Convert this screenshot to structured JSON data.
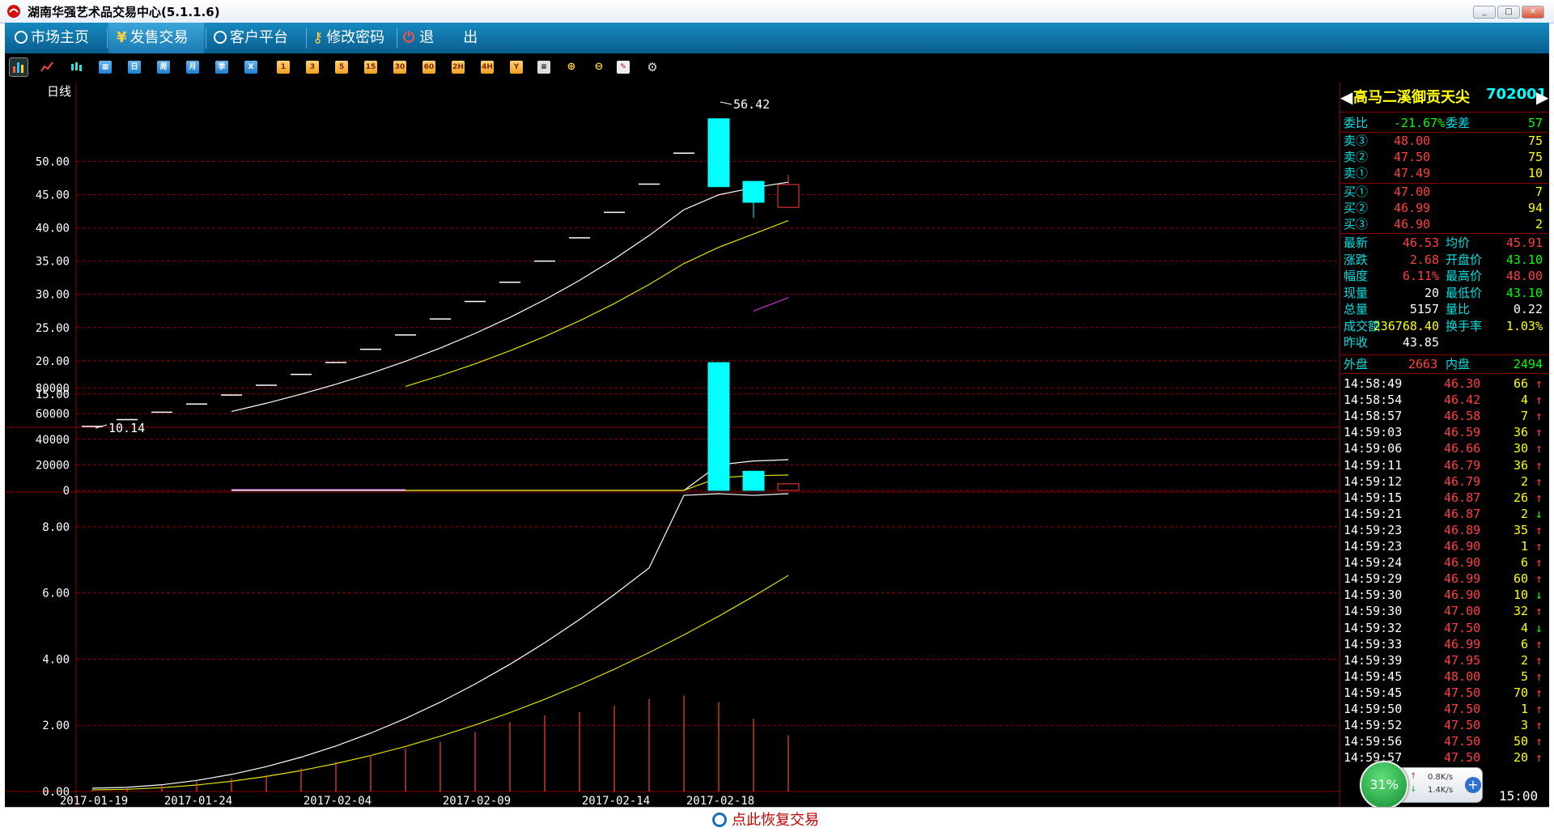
{
  "window": {
    "title": "湖南华强艺术品交易中心(5.1.1.6)",
    "controls": [
      "_",
      "□",
      "✕"
    ]
  },
  "menu": [
    {
      "label": "市场主页",
      "icon": "globe-icon"
    },
    {
      "label": "发售交易",
      "icon": "yen-icon"
    },
    {
      "label": "客户平台",
      "icon": "globe-icon"
    },
    {
      "label": "修改密码",
      "icon": "key-icon"
    },
    {
      "label": "退　　出",
      "icon": "power-icon"
    }
  ],
  "toolbar": {
    "period_buttons": [
      "日",
      "周",
      "月",
      "季",
      "X"
    ],
    "minute_buttons": [
      "1",
      "3",
      "5",
      "15",
      "30",
      "60",
      "2H",
      "4H",
      "Y"
    ]
  },
  "chart": {
    "period_label": "日线",
    "price_labels": [
      "50.00",
      "45.00",
      "40.00",
      "35.00",
      "30.00",
      "25.00",
      "20.00",
      "15.00"
    ],
    "volume_labels": [
      "80000",
      "60000",
      "40000",
      "20000",
      "0"
    ],
    "indicator_labels": [
      "8.00",
      "6.00",
      "4.00",
      "2.00",
      "0.00"
    ],
    "x_labels": [
      "2017-01-19",
      "2017-01-24",
      "2017-02-04",
      "2017-02-09",
      "2017-02-14",
      "2017-02-18"
    ],
    "max_label": "56.42",
    "min_label": "10.14"
  },
  "chart_data": {
    "type": "candlestick",
    "price_axis": {
      "ylim": [
        10,
        57
      ],
      "ticks": [
        15,
        20,
        25,
        30,
        35,
        40,
        45,
        50
      ]
    },
    "volume_axis": {
      "ylim": [
        0,
        100000
      ],
      "ticks": [
        0,
        20000,
        40000,
        60000,
        80000
      ]
    },
    "indicator_axis": {
      "ylim": [
        0,
        9
      ],
      "ticks": [
        0,
        2,
        4,
        6,
        8
      ]
    },
    "dates": [
      "2017-01-19",
      "2017-01-24",
      "2017-02-04",
      "2017-02-09",
      "2017-02-14",
      "2017-02-18"
    ],
    "candles": [
      {
        "open": 10.14,
        "close": 10.14,
        "high": 10.14,
        "low": 10.14
      },
      {
        "open": 11.15,
        "close": 11.15,
        "high": 11.15,
        "low": 11.15
      },
      {
        "open": 12.27,
        "close": 12.27,
        "high": 12.27,
        "low": 12.27
      },
      {
        "open": 13.5,
        "close": 13.5,
        "high": 13.5,
        "low": 13.5
      },
      {
        "open": 14.85,
        "close": 14.85,
        "high": 14.85,
        "low": 14.85
      },
      {
        "open": 16.33,
        "close": 16.33,
        "high": 16.33,
        "low": 16.33
      },
      {
        "open": 17.96,
        "close": 17.96,
        "high": 17.96,
        "low": 17.96
      },
      {
        "open": 19.76,
        "close": 19.76,
        "high": 19.76,
        "low": 19.76
      },
      {
        "open": 21.73,
        "close": 21.73,
        "high": 21.73,
        "low": 21.73
      },
      {
        "open": 23.9,
        "close": 23.9,
        "high": 23.9,
        "low": 23.9
      },
      {
        "open": 26.3,
        "close": 26.3,
        "high": 26.3,
        "low": 26.3
      },
      {
        "open": 28.93,
        "close": 28.93,
        "high": 28.93,
        "low": 28.93
      },
      {
        "open": 31.82,
        "close": 31.82,
        "high": 31.82,
        "low": 31.82
      },
      {
        "open": 35.0,
        "close": 35.0,
        "high": 35.0,
        "low": 35.0
      },
      {
        "open": 38.5,
        "close": 38.5,
        "high": 38.5,
        "low": 38.5
      },
      {
        "open": 42.35,
        "close": 42.35,
        "high": 42.35,
        "low": 42.35
      },
      {
        "open": 46.59,
        "close": 46.59,
        "high": 46.59,
        "low": 46.59
      },
      {
        "open": 51.25,
        "close": 51.25,
        "high": 51.25,
        "low": 51.25
      },
      {
        "open": 56.42,
        "close": 46.2,
        "high": 56.42,
        "low": 46.2
      },
      {
        "open": 47.0,
        "close": 43.85,
        "high": 47.0,
        "low": 41.5
      },
      {
        "open": 43.1,
        "close": 46.53,
        "high": 48.0,
        "low": 43.1
      }
    ],
    "volumes": [
      0,
      0,
      0,
      0,
      0,
      0,
      0,
      0,
      0,
      0,
      0,
      0,
      0,
      0,
      0,
      0,
      0,
      0,
      100000,
      15000,
      5157
    ],
    "indicator_bars": [
      0.05,
      0.1,
      0.2,
      0.3,
      0.4,
      0.5,
      0.7,
      0.9,
      1.1,
      1.3,
      1.5,
      1.8,
      2.1,
      2.3,
      2.4,
      2.6,
      2.8,
      2.9,
      2.7,
      2.2,
      1.7
    ]
  },
  "instrument": {
    "name": "高马二溪御贡天尖",
    "code": "702001"
  },
  "quote": {
    "weibi_label": "委比",
    "weibi": "-21.67%",
    "weicha_label": "委差",
    "weicha": "57",
    "asks": [
      {
        "label": "卖③",
        "price": "48.00",
        "qty": "75"
      },
      {
        "label": "卖②",
        "price": "47.50",
        "qty": "75"
      },
      {
        "label": "卖①",
        "price": "47.49",
        "qty": "10"
      }
    ],
    "bids": [
      {
        "label": "买①",
        "price": "47.00",
        "qty": "7"
      },
      {
        "label": "买②",
        "price": "46.99",
        "qty": "94"
      },
      {
        "label": "买③",
        "price": "46.90",
        "qty": "2"
      }
    ],
    "stats": [
      {
        "l1": "最新",
        "v1": "46.53",
        "l2": "均价",
        "v2": "45.91"
      },
      {
        "l1": "涨跌",
        "v1": "2.68",
        "l2": "开盘价",
        "v2": "43.10"
      },
      {
        "l1": "幅度",
        "v1": "6.11%",
        "l2": "最高价",
        "v2": "48.00"
      },
      {
        "l1": "现量",
        "v1": "20",
        "l2": "最低价",
        "v2": "43.10"
      },
      {
        "l1": "总量",
        "v1": "5157",
        "l2": "量比",
        "v2": "0.22"
      },
      {
        "l1": "成交额",
        "v1": "236768.40",
        "l2": "换手率",
        "v2": "1.03%"
      },
      {
        "l1": "昨收",
        "v1": "43.85",
        "l2": "",
        "v2": ""
      }
    ],
    "waipan_label": "外盘",
    "waipan": "2663",
    "neipan_label": "内盘",
    "neipan": "2494"
  },
  "ticks": [
    {
      "time": "14:58:49",
      "price": "46.30",
      "qty": "66",
      "dir": "up"
    },
    {
      "time": "14:58:54",
      "price": "46.42",
      "qty": "4",
      "dir": "up"
    },
    {
      "time": "14:58:57",
      "price": "46.58",
      "qty": "7",
      "dir": "up"
    },
    {
      "time": "14:59:03",
      "price": "46.59",
      "qty": "36",
      "dir": "up"
    },
    {
      "time": "14:59:06",
      "price": "46.66",
      "qty": "30",
      "dir": "up"
    },
    {
      "time": "14:59:11",
      "price": "46.79",
      "qty": "36",
      "dir": "up"
    },
    {
      "time": "14:59:12",
      "price": "46.79",
      "qty": "2",
      "dir": "up"
    },
    {
      "time": "14:59:15",
      "price": "46.87",
      "qty": "26",
      "dir": "up"
    },
    {
      "time": "14:59:21",
      "price": "46.87",
      "qty": "2",
      "dir": "down"
    },
    {
      "time": "14:59:23",
      "price": "46.89",
      "qty": "35",
      "dir": "up"
    },
    {
      "time": "14:59:23",
      "price": "46.90",
      "qty": "1",
      "dir": "up"
    },
    {
      "time": "14:59:24",
      "price": "46.90",
      "qty": "6",
      "dir": "up"
    },
    {
      "time": "14:59:29",
      "price": "46.99",
      "qty": "60",
      "dir": "up"
    },
    {
      "time": "14:59:30",
      "price": "46.90",
      "qty": "10",
      "dir": "down"
    },
    {
      "time": "14:59:30",
      "price": "47.00",
      "qty": "32",
      "dir": "up"
    },
    {
      "time": "14:59:32",
      "price": "47.50",
      "qty": "4",
      "dir": "down"
    },
    {
      "time": "14:59:33",
      "price": "46.99",
      "qty": "6",
      "dir": "up"
    },
    {
      "time": "14:59:39",
      "price": "47.95",
      "qty": "2",
      "dir": "up"
    },
    {
      "time": "14:59:45",
      "price": "48.00",
      "qty": "5",
      "dir": "up"
    },
    {
      "time": "14:59:45",
      "price": "47.50",
      "qty": "70",
      "dir": "up"
    },
    {
      "time": "14:59:50",
      "price": "47.50",
      "qty": "1",
      "dir": "up"
    },
    {
      "time": "14:59:52",
      "price": "47.50",
      "qty": "3",
      "dir": "up"
    },
    {
      "time": "14:59:56",
      "price": "47.50",
      "qty": "50",
      "dir": "up"
    },
    {
      "time": "14:59:57",
      "price": "47.50",
      "qty": "20",
      "dir": "up"
    }
  ],
  "clock": "15:00",
  "network": {
    "percent": "31%",
    "up": "0.8K/s",
    "down": "1.4K/s"
  },
  "status": {
    "restore_label": "点此恢复交易"
  },
  "colors": {
    "up": "#ff4040",
    "down": "#00ffff",
    "ma1": "#ffffff",
    "ma2": "#e0e000",
    "grid": "#8a0000",
    "accent": "#0a5d8f"
  }
}
